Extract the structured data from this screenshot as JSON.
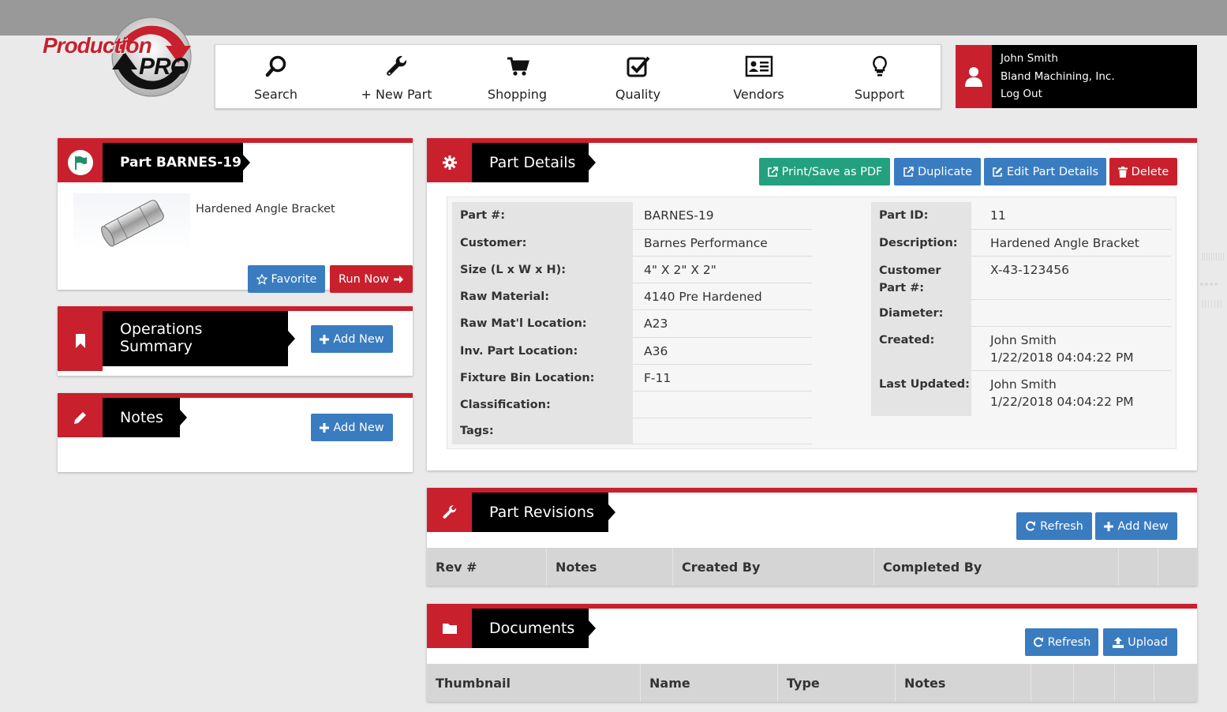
{
  "logo": {
    "word1": "Production",
    "word2": "PRO"
  },
  "nav": [
    {
      "label": "Search",
      "icon": "search-icon"
    },
    {
      "label": "+ New Part",
      "icon": "wrench-icon"
    },
    {
      "label": "Shopping",
      "icon": "cart-icon"
    },
    {
      "label": "Quality",
      "icon": "checkbox-icon"
    },
    {
      "label": "Vendors",
      "icon": "vendor-card-icon"
    },
    {
      "label": "Support",
      "icon": "lightbulb-icon"
    }
  ],
  "user": {
    "name": "John Smith",
    "company": "Bland Machining, Inc.",
    "logout": "Log Out"
  },
  "part_panel": {
    "title": "Part BARNES-19",
    "description": "Hardened Angle Bracket",
    "favorite_label": "Favorite",
    "run_now_label": "Run Now"
  },
  "operations_panel": {
    "title_line1": "Operations",
    "title_line2": "Summary",
    "add_label": "Add New"
  },
  "notes_panel": {
    "title": "Notes",
    "add_label": "Add New"
  },
  "details_panel": {
    "title": "Part Details",
    "buttons": {
      "print": "Print/Save as PDF",
      "duplicate": "Duplicate",
      "edit": "Edit Part Details",
      "delete": "Delete"
    },
    "left": [
      {
        "label": "Part #:",
        "value": "BARNES-19"
      },
      {
        "label": "Customer:",
        "value": "Barnes Performance"
      },
      {
        "label": "Size (L x W x H):",
        "value": "4\" X 2\" X 2\""
      },
      {
        "label": "Raw Material:",
        "value": "4140 Pre Hardened"
      },
      {
        "label": "Raw Mat'l Location:",
        "value": "A23"
      },
      {
        "label": "Inv. Part Location:",
        "value": "A36"
      },
      {
        "label": "Fixture Bin Location:",
        "value": "F-11"
      },
      {
        "label": "Classification:",
        "value": ""
      },
      {
        "label": "Tags:",
        "value": ""
      }
    ],
    "right": {
      "part_id_label": "Part ID:",
      "part_id": "11",
      "description_label": "Description:",
      "description": "Hardened Angle Bracket",
      "customer_part_label1": "Customer",
      "customer_part_label2": "Part #:",
      "customer_part": "X-43-123456",
      "diameter_label": "Diameter:",
      "diameter": "",
      "created_label": "Created:",
      "created_by": "John Smith",
      "created_at": "1/22/2018 04:04:22 PM",
      "updated_label": "Last Updated:",
      "updated_by": "John Smith",
      "updated_at": "1/22/2018 04:04:22 PM"
    }
  },
  "revisions_panel": {
    "title": "Part Revisions",
    "refresh_label": "Refresh",
    "add_label": "Add New",
    "columns": [
      "Rev #",
      "Notes",
      "Created By",
      "Completed By"
    ]
  },
  "documents_panel": {
    "title": "Documents",
    "refresh_label": "Refresh",
    "upload_label": "Upload",
    "columns": [
      "Thumbnail",
      "Name",
      "Type",
      "Notes"
    ]
  },
  "colors": {
    "brand_red": "#c8202d",
    "button_blue": "#3a7cc0",
    "button_green": "#23a07e"
  }
}
